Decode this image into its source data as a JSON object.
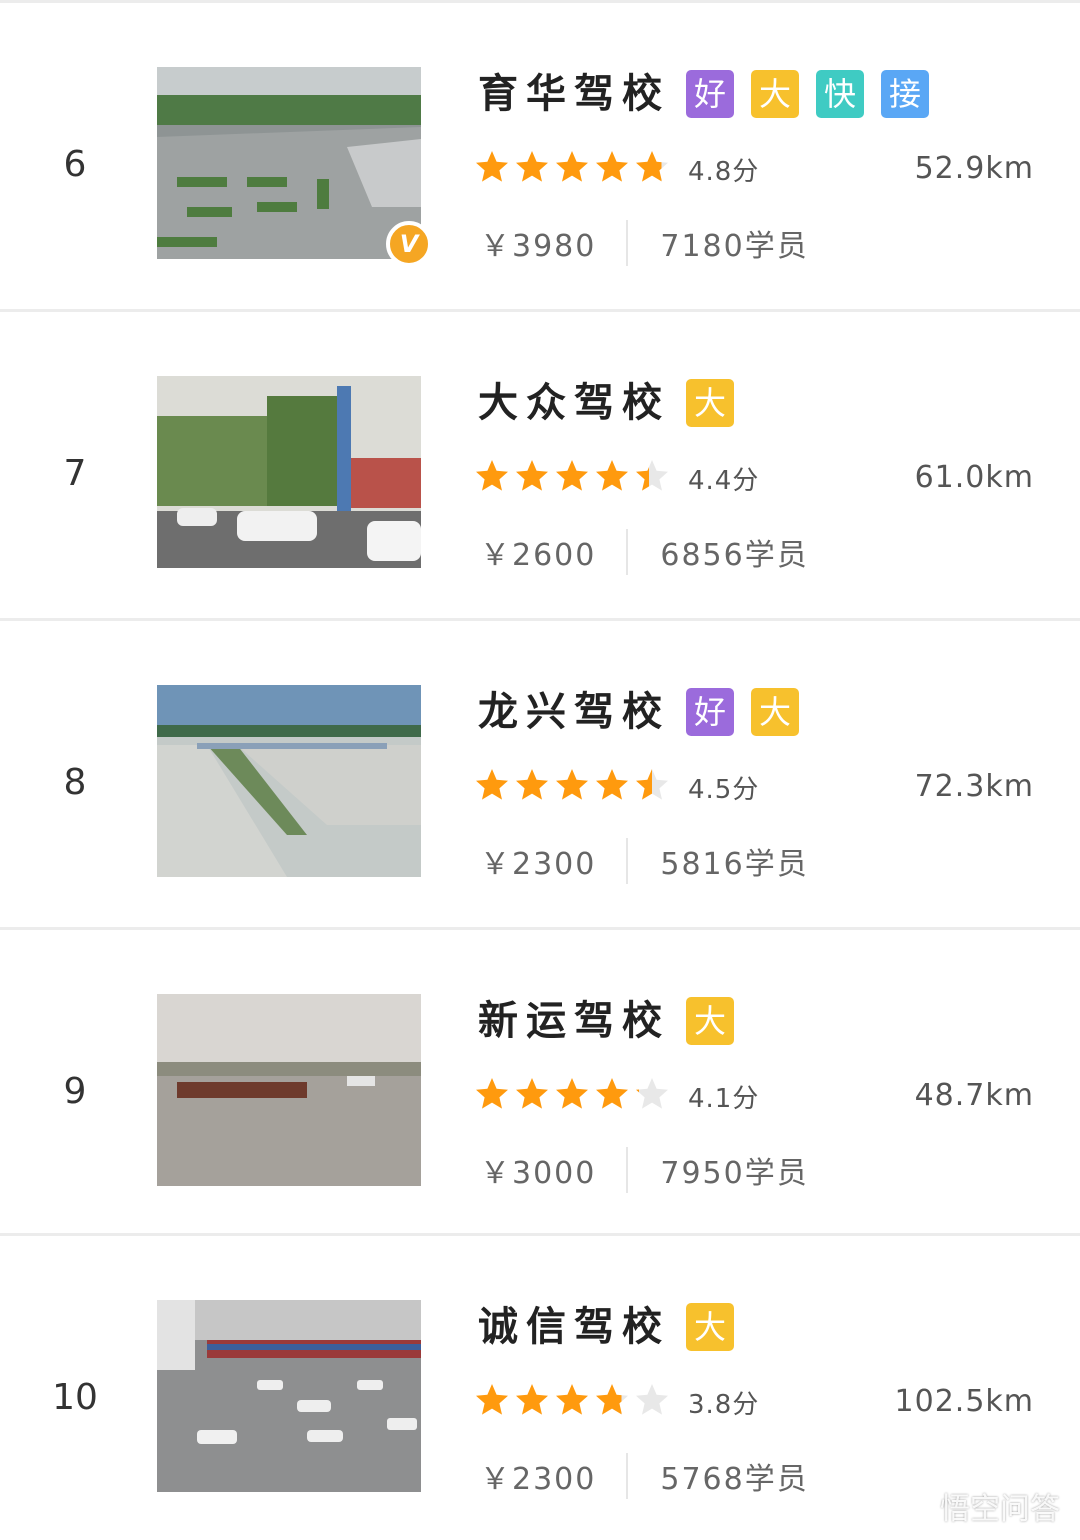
{
  "colors": {
    "star_on": "#ff9a0e",
    "star_off": "#e8e8e8",
    "tag_hao": "#9b6bdc",
    "tag_da": "#f7c12d",
    "tag_kuai": "#3fcbc3",
    "tag_jie": "#5aa7f5",
    "badge": "#f5a623"
  },
  "schools": [
    {
      "rank": "6",
      "name": "育华驾校",
      "tags": [
        {
          "label": "好",
          "kind": "hao"
        },
        {
          "label": "大",
          "kind": "da"
        },
        {
          "label": "快",
          "kind": "kuai"
        },
        {
          "label": "接",
          "kind": "jie"
        }
      ],
      "rating": 4.8,
      "score": "4.8分",
      "distance": "52.9km",
      "price": "￥3980",
      "students": "7180学员",
      "verified": true,
      "verified_label": "V"
    },
    {
      "rank": "7",
      "name": "大众驾校",
      "tags": [
        {
          "label": "大",
          "kind": "da"
        }
      ],
      "rating": 4.4,
      "score": "4.4分",
      "distance": "61.0km",
      "price": "￥2600",
      "students": "6856学员",
      "verified": false
    },
    {
      "rank": "8",
      "name": "龙兴驾校",
      "tags": [
        {
          "label": "好",
          "kind": "hao"
        },
        {
          "label": "大",
          "kind": "da"
        }
      ],
      "rating": 4.5,
      "score": "4.5分",
      "distance": "72.3km",
      "price": "￥2300",
      "students": "5816学员",
      "verified": false
    },
    {
      "rank": "9",
      "name": "新运驾校",
      "tags": [
        {
          "label": "大",
          "kind": "da"
        }
      ],
      "rating": 4.1,
      "score": "4.1分",
      "distance": "48.7km",
      "price": "￥3000",
      "students": "7950学员",
      "verified": false
    },
    {
      "rank": "10",
      "name": "诚信驾校",
      "tags": [
        {
          "label": "大",
          "kind": "da"
        }
      ],
      "rating": 3.8,
      "score": "3.8分",
      "distance": "102.5km",
      "price": "￥2300",
      "students": "5768学员",
      "verified": false
    }
  ],
  "watermark": {
    "text": "悟空问答",
    "icon": "wukong-logo-icon"
  }
}
